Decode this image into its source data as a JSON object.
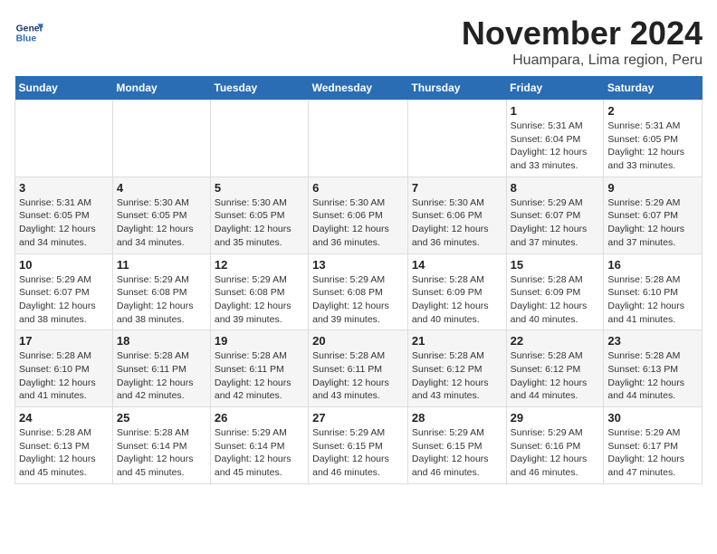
{
  "logo": {
    "line1": "General",
    "line2": "Blue"
  },
  "title": "November 2024",
  "subtitle": "Huampara, Lima region, Peru",
  "days_of_week": [
    "Sunday",
    "Monday",
    "Tuesday",
    "Wednesday",
    "Thursday",
    "Friday",
    "Saturday"
  ],
  "weeks": [
    [
      {
        "num": "",
        "info": ""
      },
      {
        "num": "",
        "info": ""
      },
      {
        "num": "",
        "info": ""
      },
      {
        "num": "",
        "info": ""
      },
      {
        "num": "",
        "info": ""
      },
      {
        "num": "1",
        "info": "Sunrise: 5:31 AM\nSunset: 6:04 PM\nDaylight: 12 hours and 33 minutes."
      },
      {
        "num": "2",
        "info": "Sunrise: 5:31 AM\nSunset: 6:05 PM\nDaylight: 12 hours and 33 minutes."
      }
    ],
    [
      {
        "num": "3",
        "info": "Sunrise: 5:31 AM\nSunset: 6:05 PM\nDaylight: 12 hours and 34 minutes."
      },
      {
        "num": "4",
        "info": "Sunrise: 5:30 AM\nSunset: 6:05 PM\nDaylight: 12 hours and 34 minutes."
      },
      {
        "num": "5",
        "info": "Sunrise: 5:30 AM\nSunset: 6:05 PM\nDaylight: 12 hours and 35 minutes."
      },
      {
        "num": "6",
        "info": "Sunrise: 5:30 AM\nSunset: 6:06 PM\nDaylight: 12 hours and 36 minutes."
      },
      {
        "num": "7",
        "info": "Sunrise: 5:30 AM\nSunset: 6:06 PM\nDaylight: 12 hours and 36 minutes."
      },
      {
        "num": "8",
        "info": "Sunrise: 5:29 AM\nSunset: 6:07 PM\nDaylight: 12 hours and 37 minutes."
      },
      {
        "num": "9",
        "info": "Sunrise: 5:29 AM\nSunset: 6:07 PM\nDaylight: 12 hours and 37 minutes."
      }
    ],
    [
      {
        "num": "10",
        "info": "Sunrise: 5:29 AM\nSunset: 6:07 PM\nDaylight: 12 hours and 38 minutes."
      },
      {
        "num": "11",
        "info": "Sunrise: 5:29 AM\nSunset: 6:08 PM\nDaylight: 12 hours and 38 minutes."
      },
      {
        "num": "12",
        "info": "Sunrise: 5:29 AM\nSunset: 6:08 PM\nDaylight: 12 hours and 39 minutes."
      },
      {
        "num": "13",
        "info": "Sunrise: 5:29 AM\nSunset: 6:08 PM\nDaylight: 12 hours and 39 minutes."
      },
      {
        "num": "14",
        "info": "Sunrise: 5:28 AM\nSunset: 6:09 PM\nDaylight: 12 hours and 40 minutes."
      },
      {
        "num": "15",
        "info": "Sunrise: 5:28 AM\nSunset: 6:09 PM\nDaylight: 12 hours and 40 minutes."
      },
      {
        "num": "16",
        "info": "Sunrise: 5:28 AM\nSunset: 6:10 PM\nDaylight: 12 hours and 41 minutes."
      }
    ],
    [
      {
        "num": "17",
        "info": "Sunrise: 5:28 AM\nSunset: 6:10 PM\nDaylight: 12 hours and 41 minutes."
      },
      {
        "num": "18",
        "info": "Sunrise: 5:28 AM\nSunset: 6:11 PM\nDaylight: 12 hours and 42 minutes."
      },
      {
        "num": "19",
        "info": "Sunrise: 5:28 AM\nSunset: 6:11 PM\nDaylight: 12 hours and 42 minutes."
      },
      {
        "num": "20",
        "info": "Sunrise: 5:28 AM\nSunset: 6:11 PM\nDaylight: 12 hours and 43 minutes."
      },
      {
        "num": "21",
        "info": "Sunrise: 5:28 AM\nSunset: 6:12 PM\nDaylight: 12 hours and 43 minutes."
      },
      {
        "num": "22",
        "info": "Sunrise: 5:28 AM\nSunset: 6:12 PM\nDaylight: 12 hours and 44 minutes."
      },
      {
        "num": "23",
        "info": "Sunrise: 5:28 AM\nSunset: 6:13 PM\nDaylight: 12 hours and 44 minutes."
      }
    ],
    [
      {
        "num": "24",
        "info": "Sunrise: 5:28 AM\nSunset: 6:13 PM\nDaylight: 12 hours and 45 minutes."
      },
      {
        "num": "25",
        "info": "Sunrise: 5:28 AM\nSunset: 6:14 PM\nDaylight: 12 hours and 45 minutes."
      },
      {
        "num": "26",
        "info": "Sunrise: 5:29 AM\nSunset: 6:14 PM\nDaylight: 12 hours and 45 minutes."
      },
      {
        "num": "27",
        "info": "Sunrise: 5:29 AM\nSunset: 6:15 PM\nDaylight: 12 hours and 46 minutes."
      },
      {
        "num": "28",
        "info": "Sunrise: 5:29 AM\nSunset: 6:15 PM\nDaylight: 12 hours and 46 minutes."
      },
      {
        "num": "29",
        "info": "Sunrise: 5:29 AM\nSunset: 6:16 PM\nDaylight: 12 hours and 46 minutes."
      },
      {
        "num": "30",
        "info": "Sunrise: 5:29 AM\nSunset: 6:17 PM\nDaylight: 12 hours and 47 minutes."
      }
    ]
  ]
}
